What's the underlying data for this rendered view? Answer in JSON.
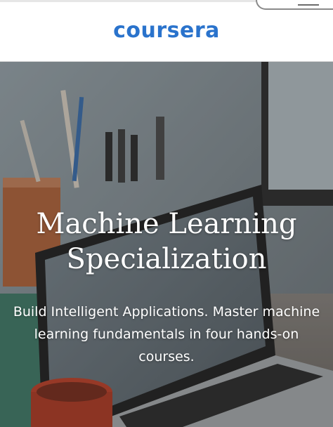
{
  "header": {
    "logo_text": "coursera",
    "logo_color": "#2a73cc",
    "menu_icon": "hamburger-menu-icon"
  },
  "hero": {
    "title_line1": "Machine Learning",
    "title_line2": "Specialization",
    "subtitle_line1": "Build Intelligent Applications. Master machine",
    "subtitle_line2": "learning fundamentals in four hands-on",
    "subtitle_line3": "courses.",
    "background_image": "laptop-on-desk-photo"
  }
}
